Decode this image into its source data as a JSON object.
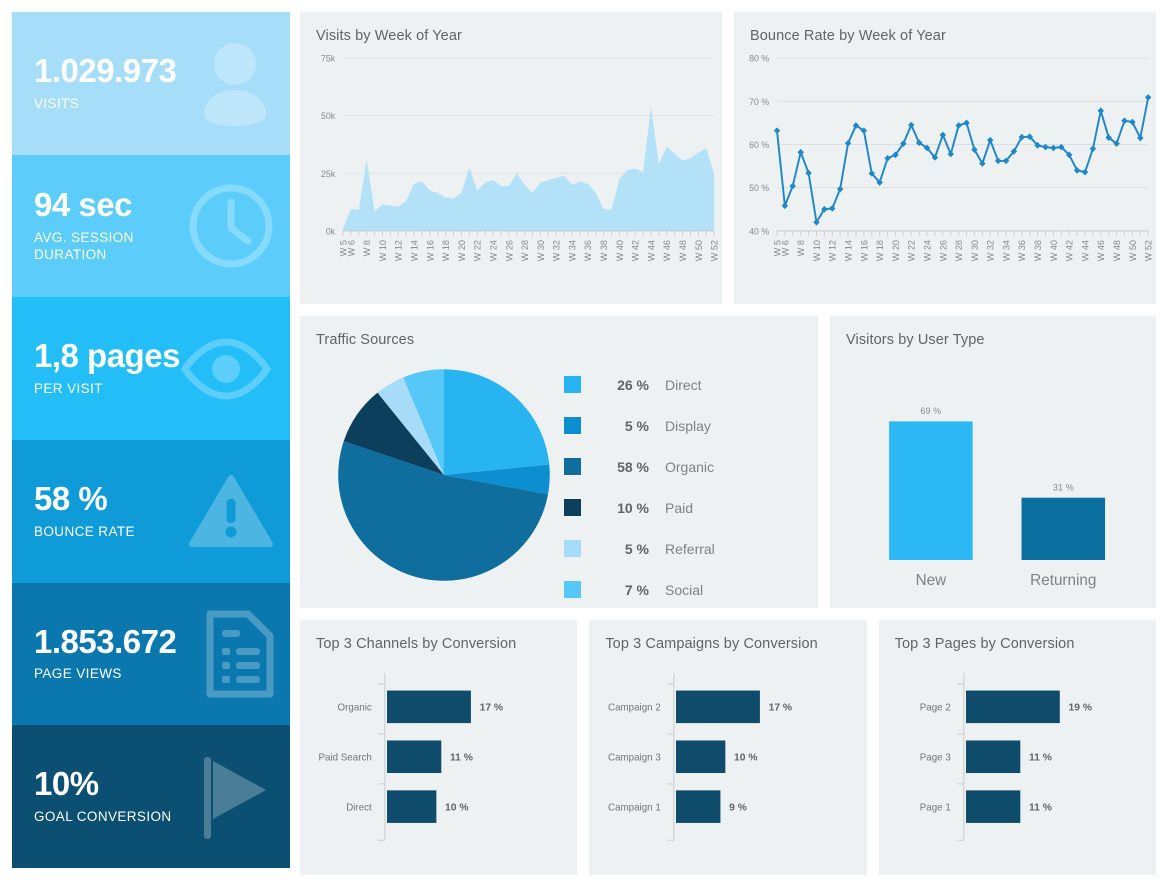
{
  "theme": {
    "page_bg": "#ffffff",
    "card_bg": "#eef1f2",
    "title_color": "#5e6468",
    "axis_color": "#85898c",
    "area_fill": "#b3e2f8",
    "line_color": "#1f88c8",
    "bar_dark": "#0f4c6b",
    "bar_light": "#2cb8f5",
    "bar_mid": "#0a72ab"
  },
  "kpis": [
    {
      "value": "1.029.973",
      "label": "VISITS",
      "bg": "#a6def9",
      "icon": "user-icon"
    },
    {
      "value": "94 sec",
      "label": "AVG. SESSION\nDURATION",
      "bg": "#5ccdfa",
      "icon": "clock-icon"
    },
    {
      "value": "1,8 pages",
      "label": "PER VISIT",
      "bg": "#23bdf8",
      "icon": "eye-icon"
    },
    {
      "value": "58 %",
      "label": "BOUNCE RATE",
      "bg": "#0f9bd7",
      "icon": "warning-icon"
    },
    {
      "value": "1.853.672",
      "label": "PAGE VIEWS",
      "bg": "#0a78ae",
      "icon": "document-icon"
    },
    {
      "value": "10%",
      "label": "GOAL CONVERSION",
      "bg": "#0b4f72",
      "icon": "flag-icon"
    }
  ],
  "cards": {
    "visits": {
      "title": "Visits by Week of Year"
    },
    "bounce": {
      "title": "Bounce Rate by Week of Year"
    },
    "traffic": {
      "title": "Traffic Sources"
    },
    "usertype": {
      "title": "Visitors by User Type"
    },
    "channels": {
      "title": "Top 3 Channels by Conversion"
    },
    "campaigns": {
      "title": "Top 3 Campaigns by Conversion"
    },
    "pages": {
      "title": "Top 3 Pages by Conversion"
    }
  },
  "chart_data": [
    {
      "id": "visits",
      "type": "area",
      "title": "Visits by Week of Year",
      "xlabel": "",
      "ylabel": "",
      "ylim": [
        0,
        75000
      ],
      "yticks": [
        0,
        25000,
        50000,
        75000
      ],
      "ytick_labels": [
        "0k",
        "25k",
        "50k",
        "75k"
      ],
      "grid": true,
      "legend": "none",
      "color": "#b3e2f8",
      "x": [
        "W 5",
        "W 6",
        "W 7",
        "W 8",
        "W 9",
        "W 10",
        "W 11",
        "W 12",
        "W 13",
        "W 14",
        "W 15",
        "W 16",
        "W 17",
        "W 18",
        "W 19",
        "W 20",
        "W 21",
        "W 22",
        "W 23",
        "W 24",
        "W 25",
        "W 26",
        "W 27",
        "W 28",
        "W 29",
        "W 30",
        "W 31",
        "W 32",
        "W 33",
        "W 34",
        "W 35",
        "W 36",
        "W 37",
        "W 38",
        "W 39",
        "W 40",
        "W 41",
        "W 42",
        "W 43",
        "W 44",
        "W 45",
        "W 46",
        "W 47",
        "W 48",
        "W 49",
        "W 50",
        "W 51",
        "W 52"
      ],
      "tick_labels": [
        "W 5",
        "W 6",
        "",
        "W 8",
        "",
        "W 10",
        "",
        "W 12",
        "",
        "W 14",
        "",
        "W 16",
        "",
        "W 18",
        "",
        "W 20",
        "",
        "W 22",
        "",
        "W 24",
        "",
        "W 26",
        "",
        "W 28",
        "",
        "W 30",
        "",
        "W 32",
        "",
        "W 34",
        "",
        "W 36",
        "",
        "W 38",
        "",
        "W 40",
        "",
        "W 42",
        "",
        "W 44",
        "",
        "W 46",
        "",
        "W 48",
        "",
        "W 50",
        "",
        "W 52"
      ],
      "values": [
        1000,
        9500,
        9200,
        31000,
        8500,
        11500,
        11000,
        10500,
        13000,
        20500,
        21500,
        17500,
        16500,
        14500,
        14000,
        16500,
        27500,
        17500,
        21000,
        22000,
        19500,
        19500,
        25000,
        20000,
        16500,
        21000,
        22000,
        23000,
        24000,
        20000,
        21500,
        20500,
        16500,
        9500,
        9200,
        22500,
        26500,
        27000,
        25500,
        54000,
        29000,
        36500,
        33500,
        30500,
        31500,
        34000,
        36000,
        24500
      ]
    },
    {
      "id": "bounce",
      "type": "line",
      "title": "Bounce Rate by Week of Year",
      "xlabel": "",
      "ylabel": "",
      "ylim": [
        40,
        80
      ],
      "yticks": [
        40,
        50,
        60,
        70,
        80
      ],
      "ytick_labels": [
        "40 %",
        "50 %",
        "60 %",
        "70 %",
        "80 %"
      ],
      "grid": true,
      "legend": "none",
      "color": "#1f88c8",
      "marker": "diamond",
      "x": [
        "W 5",
        "W 6",
        "W 7",
        "W 8",
        "W 9",
        "W 10",
        "W 11",
        "W 12",
        "W 13",
        "W 14",
        "W 15",
        "W 16",
        "W 17",
        "W 18",
        "W 19",
        "W 20",
        "W 21",
        "W 22",
        "W 23",
        "W 24",
        "W 25",
        "W 26",
        "W 27",
        "W 28",
        "W 29",
        "W 30",
        "W 31",
        "W 32",
        "W 33",
        "W 34",
        "W 35",
        "W 36",
        "W 37",
        "W 38",
        "W 39",
        "W 40",
        "W 41",
        "W 42",
        "W 43",
        "W 44",
        "W 45",
        "W 46",
        "W 47",
        "W 48",
        "W 49",
        "W 50",
        "W 51",
        "W 52"
      ],
      "tick_labels": [
        "W 5",
        "W 6",
        "",
        "W 8",
        "",
        "W 10",
        "",
        "W 12",
        "",
        "W 14",
        "",
        "W 16",
        "",
        "W 18",
        "",
        "W 20",
        "",
        "W 22",
        "",
        "W 24",
        "",
        "W 26",
        "",
        "W 28",
        "",
        "W 30",
        "",
        "W 32",
        "",
        "W 34",
        "",
        "W 36",
        "",
        "W 38",
        "",
        "W 40",
        "",
        "W 42",
        "",
        "W 44",
        "",
        "W 46",
        "",
        "W 48",
        "",
        "W 50",
        "",
        "W 52"
      ],
      "values": [
        63.2,
        45.8,
        50.4,
        58.2,
        53.4,
        42.0,
        45.0,
        45.2,
        49.7,
        60.3,
        64.4,
        63.2,
        53.3,
        51.2,
        56.8,
        57.6,
        60.2,
        64.5,
        60.4,
        59.2,
        57.0,
        62.2,
        57.8,
        64.4,
        65.0,
        58.8,
        55.6,
        61.0,
        56.2,
        56.2,
        58.4,
        61.7,
        61.8,
        59.8,
        59.4,
        59.2,
        59.4,
        57.6,
        54.0,
        53.6,
        59.0,
        67.8,
        61.6,
        60.2,
        65.5,
        65.2,
        61.5,
        70.9
      ]
    },
    {
      "id": "traffic",
      "type": "pie",
      "title": "Traffic Sources",
      "legend": "right",
      "labels": [
        "Direct",
        "Display",
        "Organic",
        "Paid",
        "Referral",
        "Social"
      ],
      "values": [
        26,
        5,
        58,
        10,
        5,
        7
      ],
      "value_labels": [
        "26 %",
        "5 %",
        "58 %",
        "10 %",
        "5 %",
        "7 %"
      ],
      "colors": [
        "#27b4f0",
        "#0b8fd1",
        "#0f6e9e",
        "#0c3f5c",
        "#a6dcf7",
        "#55c8f7"
      ]
    },
    {
      "id": "usertype",
      "type": "bar",
      "title": "Visitors by User Type",
      "categories": [
        "New",
        "Returning"
      ],
      "values": [
        69,
        31
      ],
      "value_labels": [
        "69 %",
        "31 %"
      ],
      "colors": [
        "#2cb8f5",
        "#0a6f9f"
      ],
      "ylim": [
        0,
        80
      ],
      "grid": false,
      "legend": "none"
    },
    {
      "id": "channels",
      "type": "bar",
      "orientation": "horizontal",
      "title": "Top 3 Channels by Conversion",
      "categories": [
        "Organic",
        "Paid Search",
        "Direct"
      ],
      "values": [
        17,
        11,
        10
      ],
      "value_labels": [
        "17 %",
        "11 %",
        "10 %"
      ],
      "color": "#0f4c6b",
      "xlim": [
        0,
        26
      ],
      "grid": false,
      "legend": "none"
    },
    {
      "id": "campaigns",
      "type": "bar",
      "orientation": "horizontal",
      "title": "Top 3 Campaigns by Conversion",
      "categories": [
        "Campaign 2",
        "Campaign 3",
        "Campaign 1"
      ],
      "values": [
        17,
        10,
        9
      ],
      "value_labels": [
        "17 %",
        "10 %",
        "9 %"
      ],
      "color": "#0f4c6b",
      "xlim": [
        0,
        26
      ],
      "grid": false,
      "legend": "none"
    },
    {
      "id": "pages",
      "type": "bar",
      "orientation": "horizontal",
      "title": "Top 3 Pages by Conversion",
      "categories": [
        "Page 2",
        "Page 3",
        "Page 1"
      ],
      "values": [
        19,
        11,
        11
      ],
      "value_labels": [
        "19 %",
        "11 %",
        "11 %"
      ],
      "color": "#0f4c6b",
      "xlim": [
        0,
        26
      ],
      "grid": false,
      "legend": "none"
    }
  ]
}
